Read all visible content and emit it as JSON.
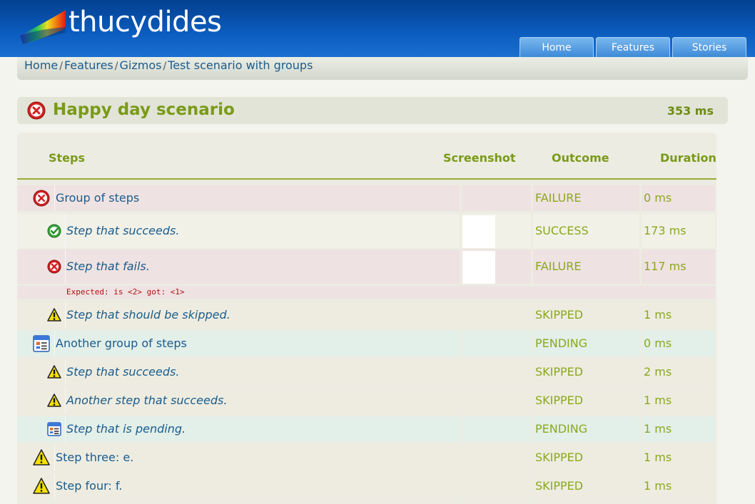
{
  "header": {
    "logo_text": "thucydides",
    "tabs": [
      "Home",
      "Features",
      "Stories"
    ]
  },
  "breadcrumb": [
    "Home",
    "Features",
    "Gizmos",
    "Test scenario with groups"
  ],
  "scenario": {
    "title": "Happy day scenario",
    "duration": "353 ms",
    "status_icon": "failure-icon"
  },
  "table": {
    "headers": {
      "steps": "Steps",
      "screenshot": "Screenshot",
      "outcome": "Outcome",
      "duration": "Duration"
    },
    "rows": [
      {
        "step": "Group of steps",
        "outcome": "FAILURE",
        "duration": "0 ms",
        "icon": "failure-icon",
        "level": "group"
      },
      {
        "step": "Step that succeeds.",
        "outcome": "SUCCESS",
        "duration": "173 ms",
        "icon": "success-icon",
        "level": "sub"
      },
      {
        "step": "Step that fails.",
        "outcome": "FAILURE",
        "duration": "117 ms",
        "icon": "failure-icon",
        "level": "sub"
      },
      {
        "step": "Step that should be skipped.",
        "outcome": "SKIPPED",
        "duration": "1 ms",
        "icon": "warning-icon",
        "level": "sub"
      },
      {
        "step": "Another group of steps",
        "outcome": "PENDING",
        "duration": "0 ms",
        "icon": "pending-icon",
        "level": "group"
      },
      {
        "step": "Step that succeeds.",
        "outcome": "SKIPPED",
        "duration": "2 ms",
        "icon": "warning-icon",
        "level": "sub"
      },
      {
        "step": "Another step that succeeds.",
        "outcome": "SKIPPED",
        "duration": "1 ms",
        "icon": "warning-icon",
        "level": "sub"
      },
      {
        "step": "Step that is pending.",
        "outcome": "PENDING",
        "duration": "1 ms",
        "icon": "pending-icon",
        "level": "sub"
      },
      {
        "step": "Step three: e.",
        "outcome": "SKIPPED",
        "duration": "1 ms",
        "icon": "warning-icon",
        "level": "group"
      },
      {
        "step": "Step four: f.",
        "outcome": "SKIPPED",
        "duration": "1 ms",
        "icon": "warning-icon",
        "level": "group"
      }
    ],
    "error_message": "Expected: is <2> got: <1>"
  },
  "colors": {
    "header_blue": "#0a5bbd",
    "accent_green": "#7a9a18",
    "link_blue": "#1a5c8c",
    "failure_row": "#efe2e2",
    "success_row": "#f1f1e8",
    "skipped_row": "#eeece0",
    "pending_row": "#e3efe9",
    "error_red": "#b01010"
  }
}
